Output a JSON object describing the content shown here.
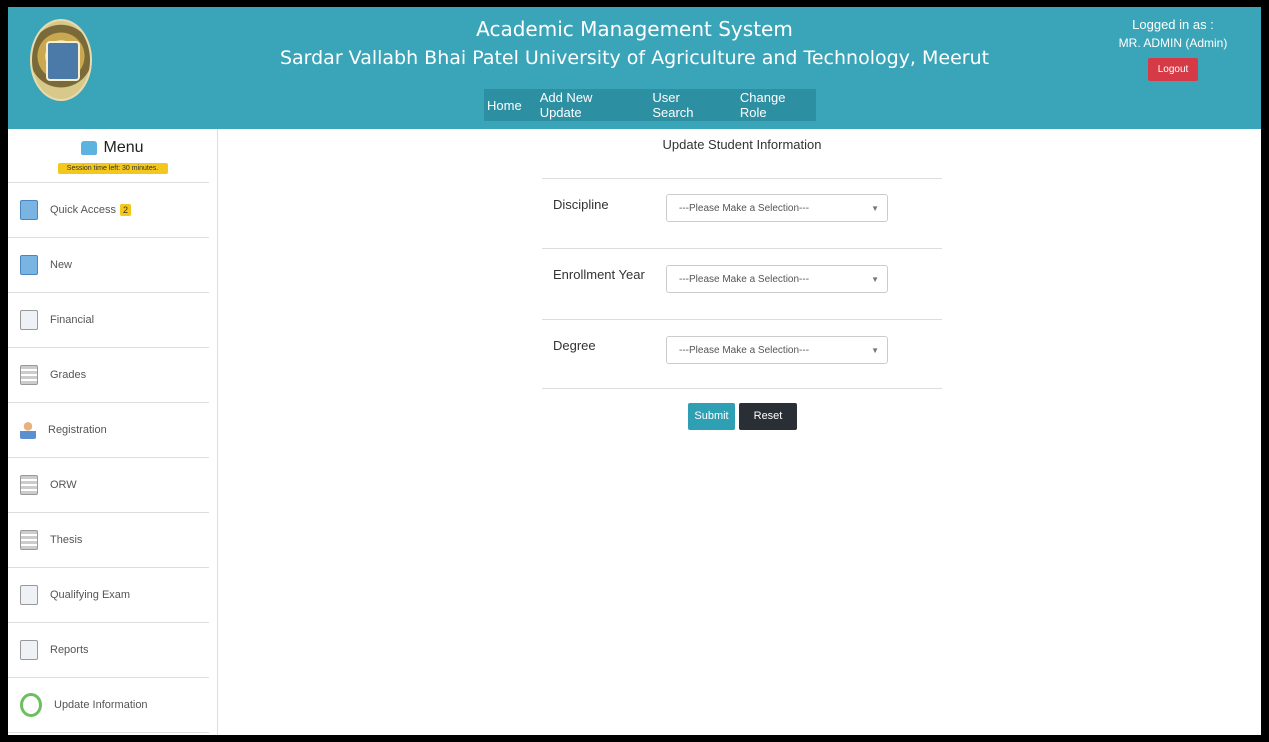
{
  "header": {
    "title": "Academic Management System",
    "subtitle": "Sardar Vallabh Bhai Patel University of Agriculture and Technology, Meerut",
    "nav": [
      "Home",
      "Add New Update",
      "User Search",
      "Change Role"
    ],
    "logged_in_label": "Logged in as :",
    "user": "MR. ADMIN (Admin)",
    "logout_label": "Logout",
    "color": "#3aa5b8"
  },
  "sidebar": {
    "menu_label": "Menu",
    "session_text": "Session time left: 30 minutes.",
    "items": [
      {
        "label": "Quick Access",
        "badge": "2",
        "icon": "quick-access-icon"
      },
      {
        "label": "New",
        "icon": "new-icon"
      },
      {
        "label": "Financial",
        "icon": "financial-icon"
      },
      {
        "label": "Grades",
        "icon": "grades-icon"
      },
      {
        "label": "Registration",
        "icon": "registration-icon"
      },
      {
        "label": "ORW",
        "icon": "orw-icon"
      },
      {
        "label": "Thesis",
        "icon": "thesis-icon"
      },
      {
        "label": "Qualifying Exam",
        "icon": "qualifying-exam-icon"
      },
      {
        "label": "Reports",
        "icon": "reports-icon"
      },
      {
        "label": "Update Information",
        "icon": "update-information-icon"
      }
    ]
  },
  "form": {
    "title": "Update Student Information",
    "fields": [
      {
        "label": "Discipline",
        "value": "---Please Make a Selection---"
      },
      {
        "label": "Enrollment Year",
        "value": "---Please Make a Selection---"
      },
      {
        "label": "Degree",
        "value": "---Please Make a Selection---"
      }
    ],
    "submit_label": "Submit",
    "reset_label": "Reset"
  }
}
